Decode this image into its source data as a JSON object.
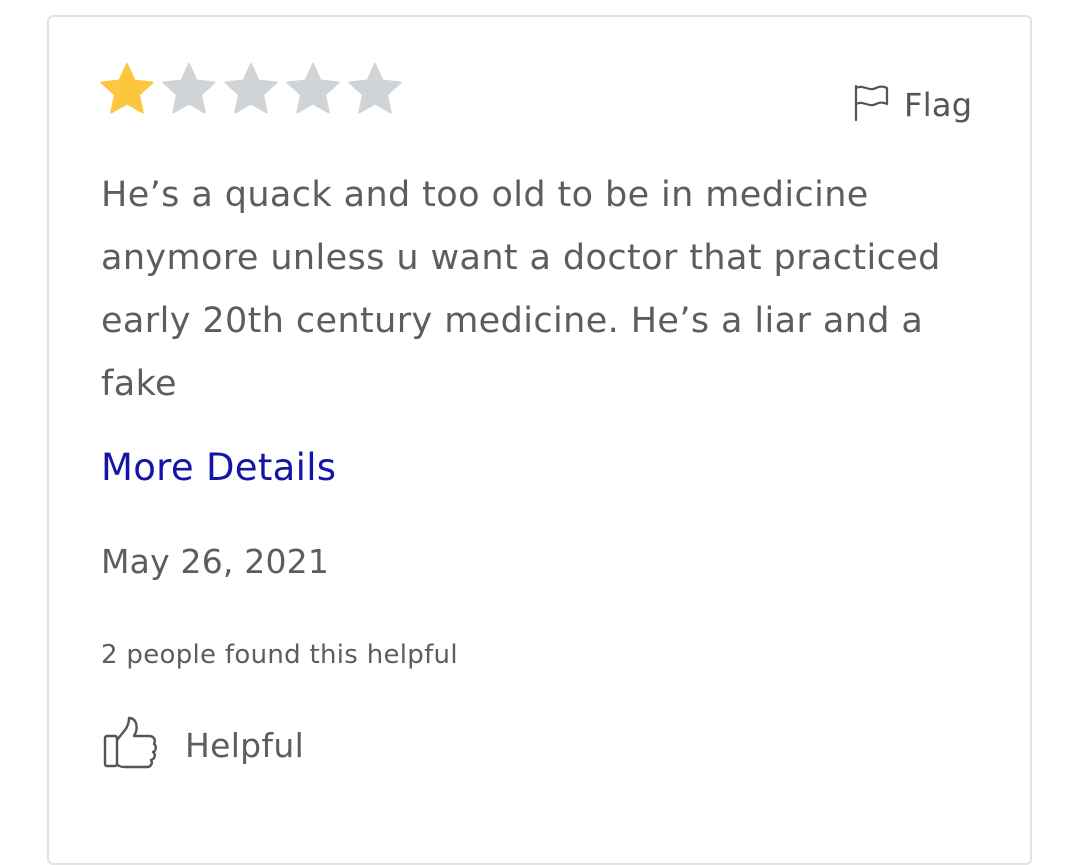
{
  "review": {
    "rating": 1,
    "max_rating": 5,
    "star_filled_color": "#fcc63f",
    "star_empty_color": "#d0d4d6",
    "flag_label": "Flag",
    "flag_icon": "flag-icon",
    "text": "He’s a quack and too old to be in medicine anymore unless u want a doctor that practiced early 20th century medicine. He’s a liar and a fake",
    "more_details_label": "More Details",
    "link_color": "#1414a8",
    "date": "May 26, 2021",
    "helpful_count_text": "2 people found this helpful",
    "helpful_label": "Helpful",
    "helpful_icon": "thumbs-up-icon"
  }
}
